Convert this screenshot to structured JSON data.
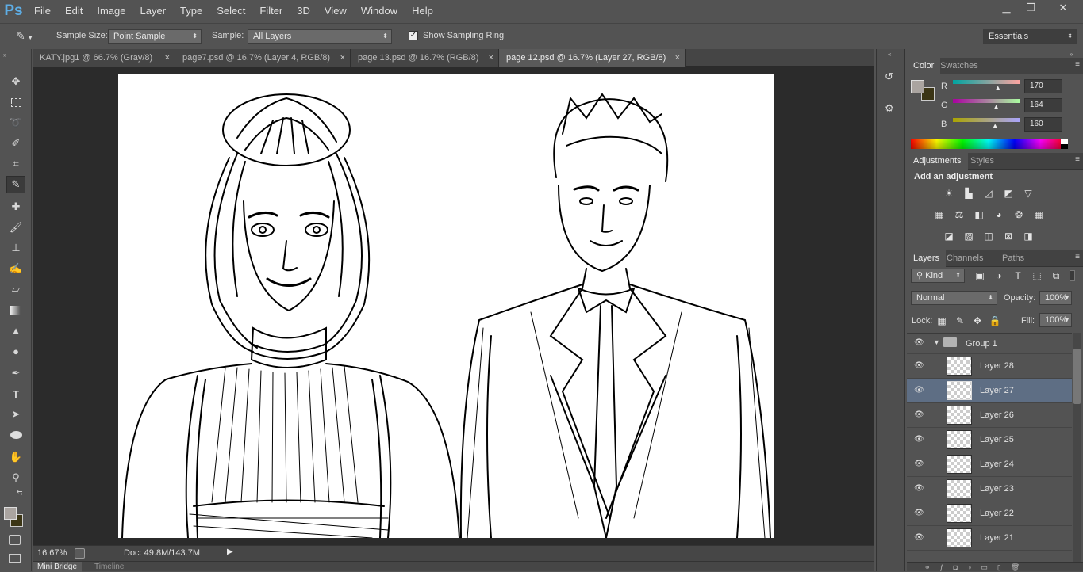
{
  "app": {
    "logo": "Ps"
  },
  "menu": [
    "File",
    "Edit",
    "Image",
    "Layer",
    "Type",
    "Select",
    "Filter",
    "3D",
    "View",
    "Window",
    "Help"
  ],
  "window_controls": {
    "minimize": "▁",
    "restore": "❐",
    "close": "✕"
  },
  "options": {
    "sample_size_label": "Sample Size:",
    "sample_size_value": "Point Sample",
    "sample_label": "Sample:",
    "sample_value": "All Layers",
    "show_ring_label": "Show Sampling Ring",
    "workspace_value": "Essentials"
  },
  "tabs": [
    {
      "label": "KATY.jpg1 @ 66.7% (Gray/8)",
      "close": "×"
    },
    {
      "label": "page7.psd @ 16.7% (Layer 4, RGB/8)",
      "close": "×"
    },
    {
      "label": "page 13.psd @ 16.7% (RGB/8)",
      "close": "×"
    },
    {
      "label": "page 12.psd @ 16.7% (Layer 27, RGB/8)",
      "close": "×"
    }
  ],
  "status": {
    "zoom": "16.67%",
    "doc": "Doc: 49.8M/143.7M"
  },
  "bottom_tabs": [
    "Mini Bridge",
    "Timeline"
  ],
  "color_panel": {
    "tabs": [
      "Color",
      "Swatches"
    ],
    "r_label": "R",
    "g_label": "G",
    "b_label": "B",
    "r": "170",
    "g": "164",
    "b": "160",
    "r_level": 0.667,
    "g_level": 0.643,
    "b_level": 0.627,
    "foreground": "#aaa4a0",
    "background": "#3b3515"
  },
  "adjustments_panel": {
    "tabs": [
      "Adjustments",
      "Styles"
    ],
    "heading": "Add an adjustment"
  },
  "layers_panel": {
    "tabs": [
      "Layers",
      "Channels",
      "Paths"
    ],
    "filter_value": "Kind",
    "blend_mode": "Normal",
    "opacity_label": "Opacity:",
    "opacity_value": "100%",
    "lock_label": "Lock:",
    "fill_label": "Fill:",
    "fill_value": "100%",
    "group_name": "Group 1",
    "layers": [
      "Layer 28",
      "Layer 27",
      "Layer 26",
      "Layer 25",
      "Layer 24",
      "Layer 23",
      "Layer 22",
      "Layer 21"
    ],
    "selected_layer": "Layer 27"
  }
}
